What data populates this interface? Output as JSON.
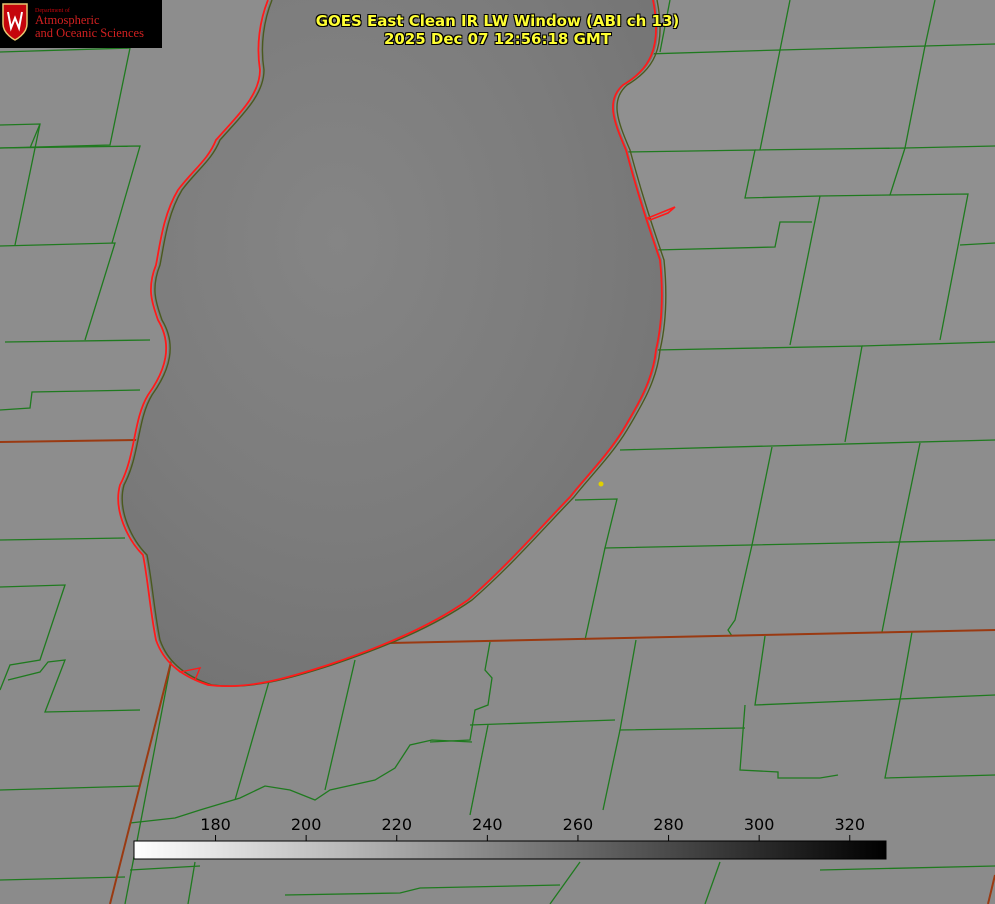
{
  "title": {
    "line1": "GOES East Clean IR LW Window (ABI ch 13)",
    "line2": "2025 Dec 07 12:56:18 GMT"
  },
  "logo": {
    "dept": "Department of",
    "line1": "Atmospheric",
    "line2": "and Oceanic Sciences"
  },
  "colorbar": {
    "ticks": [
      "180",
      "200",
      "220",
      "240",
      "260",
      "280",
      "300",
      "320"
    ],
    "min": 162,
    "max": 328,
    "gradient_from": "#ffffff",
    "gradient_to": "#000000"
  },
  "colors": {
    "county_lines": "#1f7a1f",
    "state_lines": "#9a3a12",
    "coastline": "#ff1a1a",
    "title": "#ffff33",
    "marker": "#e0d000",
    "land": "#8c8c8c",
    "lake": "#7b7b7b"
  }
}
